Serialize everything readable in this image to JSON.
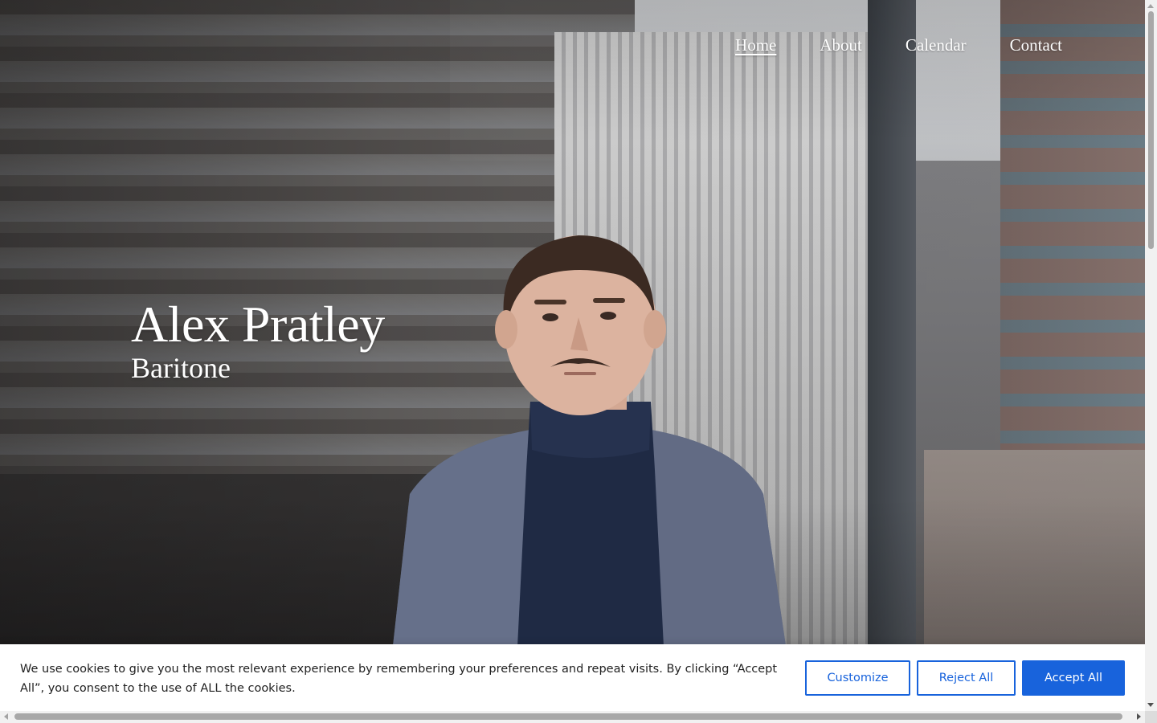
{
  "nav": {
    "items": [
      {
        "label": "Home",
        "active": true
      },
      {
        "label": "About",
        "active": false
      },
      {
        "label": "Calendar",
        "active": false
      },
      {
        "label": "Contact",
        "active": false
      }
    ]
  },
  "hero": {
    "name": "Alex Pratley",
    "subtitle": "Baritone"
  },
  "cookie_banner": {
    "text": "We use cookies to give you the most relevant experience by remembering your preferences and repeat visits. By clicking “Accept All”, you consent to the use of ALL the cookies.",
    "customize_label": "Customize",
    "reject_label": "Reject All",
    "accept_label": "Accept All",
    "colors": {
      "accent": "#1863dc"
    }
  },
  "colors": {
    "nav_text": "#ffffff",
    "hero_text": "#ffffff"
  }
}
